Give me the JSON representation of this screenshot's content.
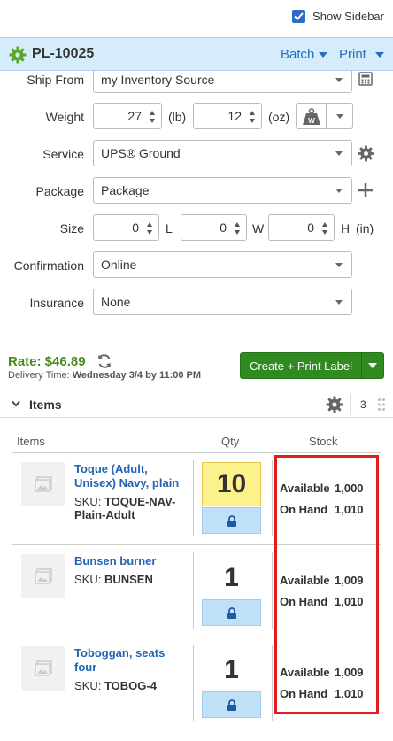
{
  "topbar": {
    "show_sidebar_label": "Show Sidebar",
    "show_sidebar_checked": true
  },
  "header": {
    "title": "PL-10025",
    "batch_label": "Batch",
    "print_label": "Print",
    "icon": "gear-icon"
  },
  "form": {
    "ship_from": {
      "label": "Ship From",
      "value": "my Inventory Source"
    },
    "weight": {
      "label": "Weight",
      "lb_value": "27",
      "lb_unit": "(lb)",
      "oz_value": "12",
      "oz_unit": "(oz)"
    },
    "service": {
      "label": "Service",
      "value": "UPS® Ground"
    },
    "package": {
      "label": "Package",
      "value": "Package"
    },
    "size": {
      "label": "Size",
      "l_value": "0",
      "l_unit": "L",
      "w_value": "0",
      "w_unit": "W",
      "h_value": "0",
      "h_unit": "H",
      "unit": "(in)"
    },
    "confirmation": {
      "label": "Confirmation",
      "value": "Online"
    },
    "insurance": {
      "label": "Insurance",
      "value": "None"
    }
  },
  "rate": {
    "rate_text": "Rate: $46.89",
    "delivery_prefix": "Delivery Time: ",
    "delivery_value": "Wednesday 3/4 by 11:00 PM",
    "create_label": "Create + Print Label"
  },
  "items_section": {
    "title": "Items",
    "count": "3",
    "col_items": "Items",
    "col_qty": "Qty",
    "col_stock": "Stock",
    "rows": [
      {
        "name": "Toque (Adult, Unisex) Navy, plain",
        "sku_prefix": "SKU: ",
        "sku": "TOQUE-NAV-Plain-Adult",
        "qty": "10",
        "available_label": "Available",
        "available": "1,000",
        "on_hand_label": "On Hand",
        "on_hand": "1,010"
      },
      {
        "name": "Bunsen burner",
        "sku_prefix": "SKU: ",
        "sku": "BUNSEN",
        "qty": "1",
        "available_label": "Available",
        "available": "1,009",
        "on_hand_label": "On Hand",
        "on_hand": "1,010"
      },
      {
        "name": "Toboggan, seats four",
        "sku_prefix": "SKU: ",
        "sku": "TOBOG-4",
        "qty": "1",
        "available_label": "Available",
        "available": "1,009",
        "on_hand_label": "On Hand",
        "on_hand": "1,010"
      }
    ]
  },
  "colors": {
    "accent_blue": "#2a6fbb",
    "header_bg": "#d5ecfa",
    "rate_green": "#4a8a1e",
    "button_green": "#2f8a1f",
    "highlight_red": "#e21b1b",
    "qty_highlight": "#fbf28c"
  }
}
